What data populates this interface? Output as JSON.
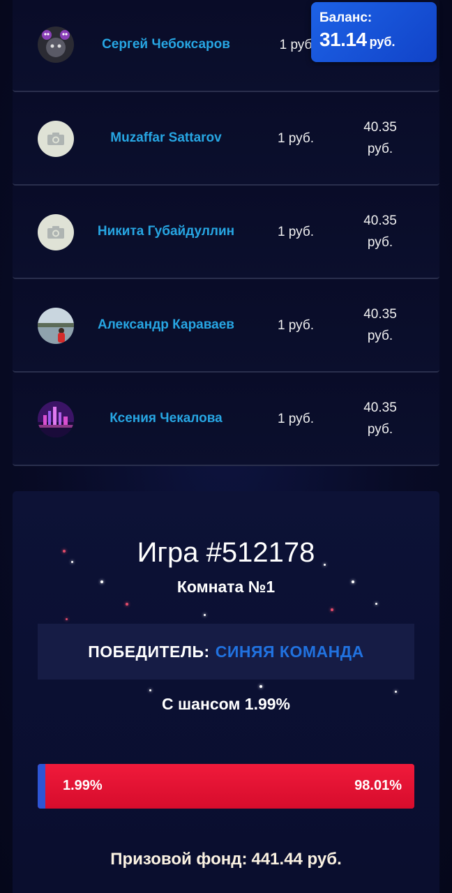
{
  "balance": {
    "label": "Баланс:",
    "amount": "31.14",
    "currency": "руб."
  },
  "players": [
    {
      "name": "Сергей Чебоксаров",
      "bet": "1 руб",
      "win_amount": "",
      "win_currency": "",
      "avatar": "cat-photo"
    },
    {
      "name": "Muzaffar Sattarov",
      "bet": "1 руб.",
      "win_amount": "40.35",
      "win_currency": "руб.",
      "avatar": "camera-placeholder"
    },
    {
      "name": "Никита Губайдуллин",
      "bet": "1 руб.",
      "win_amount": "40.35",
      "win_currency": "руб.",
      "avatar": "camera-placeholder"
    },
    {
      "name": "Александр Караваев",
      "bet": "1 руб.",
      "win_amount": "40.35",
      "win_currency": "руб.",
      "avatar": "lake-photo"
    },
    {
      "name": "Ксения Чекалова",
      "bet": "1 руб.",
      "win_amount": "40.35",
      "win_currency": "руб.",
      "avatar": "city-night-photo"
    }
  ],
  "game": {
    "title": "Игра #512178",
    "room": "Комната №1",
    "winner_label": "ПОБЕДИТЕЛЬ:",
    "winner_team": "СИНЯЯ КОМАНДА",
    "chance_text": "С шансом 1.99%",
    "blue_percent": 1.99,
    "red_percent": 98.01,
    "blue_percent_label": "1.99%",
    "red_percent_label": "98.01%",
    "prize_label": "Призовой фонд:",
    "prize_amount": "441.44 руб."
  },
  "colors": {
    "player_name": "#27a6e3",
    "blue_team": "#2172e0",
    "red_team": "#e31234",
    "balance_bg": "#1d62e6"
  }
}
